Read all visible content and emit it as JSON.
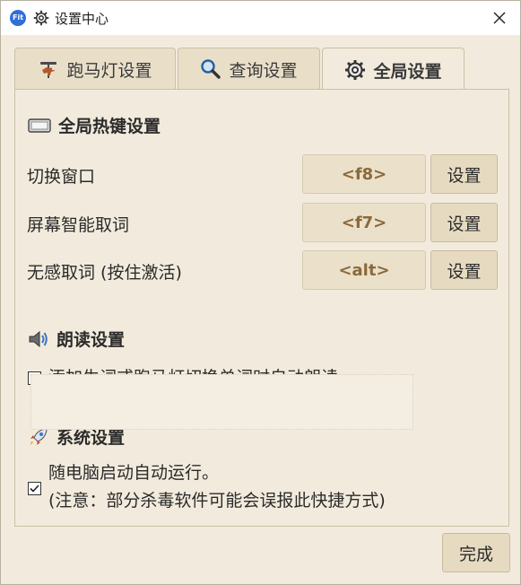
{
  "window": {
    "app_icon_text": "Fit",
    "title": "设置中心"
  },
  "tabs": [
    {
      "label": "跑马灯设置",
      "icon": "carousel-horse-icon",
      "active": false
    },
    {
      "label": "查询设置",
      "icon": "magnifier-icon",
      "active": false
    },
    {
      "label": "全局设置",
      "icon": "gear-icon",
      "active": true
    }
  ],
  "hotkeys": {
    "title": "全局热键设置",
    "rows": [
      {
        "label": "切换窗口",
        "key": "<f8>",
        "button": "设置"
      },
      {
        "label": "屏幕智能取词",
        "key": "<f7>",
        "button": "设置"
      },
      {
        "label": "无感取词 (按住激活)",
        "key": "<alt>",
        "button": "设置"
      }
    ]
  },
  "reading": {
    "title": "朗读设置",
    "auto_read_label": "添加生词或跑马灯切换单词时自动朗读",
    "auto_read_checked": false
  },
  "system": {
    "title": "系统设置",
    "startup_line1": "随电脑启动自动运行。",
    "startup_line2": "(注意：部分杀毒软件可能会误报此快捷方式)",
    "startup_checked": true
  },
  "footer": {
    "done_label": "完成"
  },
  "colors": {
    "background": "#f2ebdd",
    "hotkey_text": "#8a6a3c",
    "button": "#e6dbc1"
  }
}
